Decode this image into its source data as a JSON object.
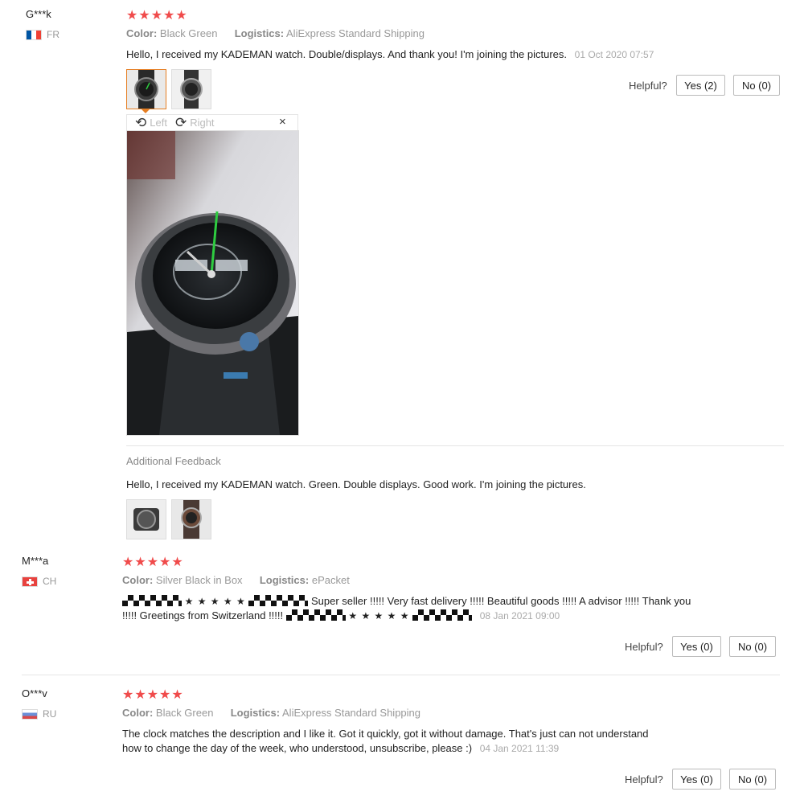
{
  "reviews": [
    {
      "user": "G***k",
      "country": "FR",
      "stars": "★★★★★",
      "color_label": "Color:",
      "color_value": "Black Green",
      "logistics_label": "Logistics:",
      "logistics_value": "AliExpress Standard Shipping",
      "text": "Hello, I received my KADEMAN watch. Double/displays. And thank you! I'm joining the pictures.",
      "date": "01 Oct 2020 07:57",
      "helpful_label": "Helpful?",
      "yes_label": "Yes (2)",
      "no_label": "No (0)",
      "viewer": {
        "left_label": "Left",
        "right_label": "Right",
        "close_icon": "×"
      },
      "additional_title": "Additional Feedback",
      "additional_text": "Hello, I received my KADEMAN watch. Green. Double displays. Good work. I'm joining the pictures."
    },
    {
      "user": "M***a",
      "country": "CH",
      "stars": "★★★★★",
      "color_label": "Color:",
      "color_value": "Silver Black in Box",
      "logistics_label": "Logistics:",
      "logistics_value": "ePacket",
      "text_stars": "★ ★ ★ ★ ★",
      "text_line1": "Super seller !!!!! Very fast delivery !!!!! Beautiful goods !!!!! A advisor !!!!! Thank you",
      "text_line2": "!!!!! Greetings from Switzerland !!!!!",
      "date": "08 Jan 2021 09:00",
      "helpful_label": "Helpful?",
      "yes_label": "Yes (0)",
      "no_label": "No (0)"
    },
    {
      "user": "O***v",
      "country": "RU",
      "stars": "★★★★★",
      "color_label": "Color:",
      "color_value": "Black Green",
      "logistics_label": "Logistics:",
      "logistics_value": "AliExpress Standard Shipping",
      "text_line1": "The clock matches the description and I like it. Got it quickly, got it without damage. That's just can not understand",
      "text_line2": "how to change the day of the week, who understood, unsubscribe, please :)",
      "date": "04 Jan 2021 11:39",
      "helpful_label": "Helpful?",
      "yes_label": "Yes (0)",
      "no_label": "No (0)"
    }
  ]
}
